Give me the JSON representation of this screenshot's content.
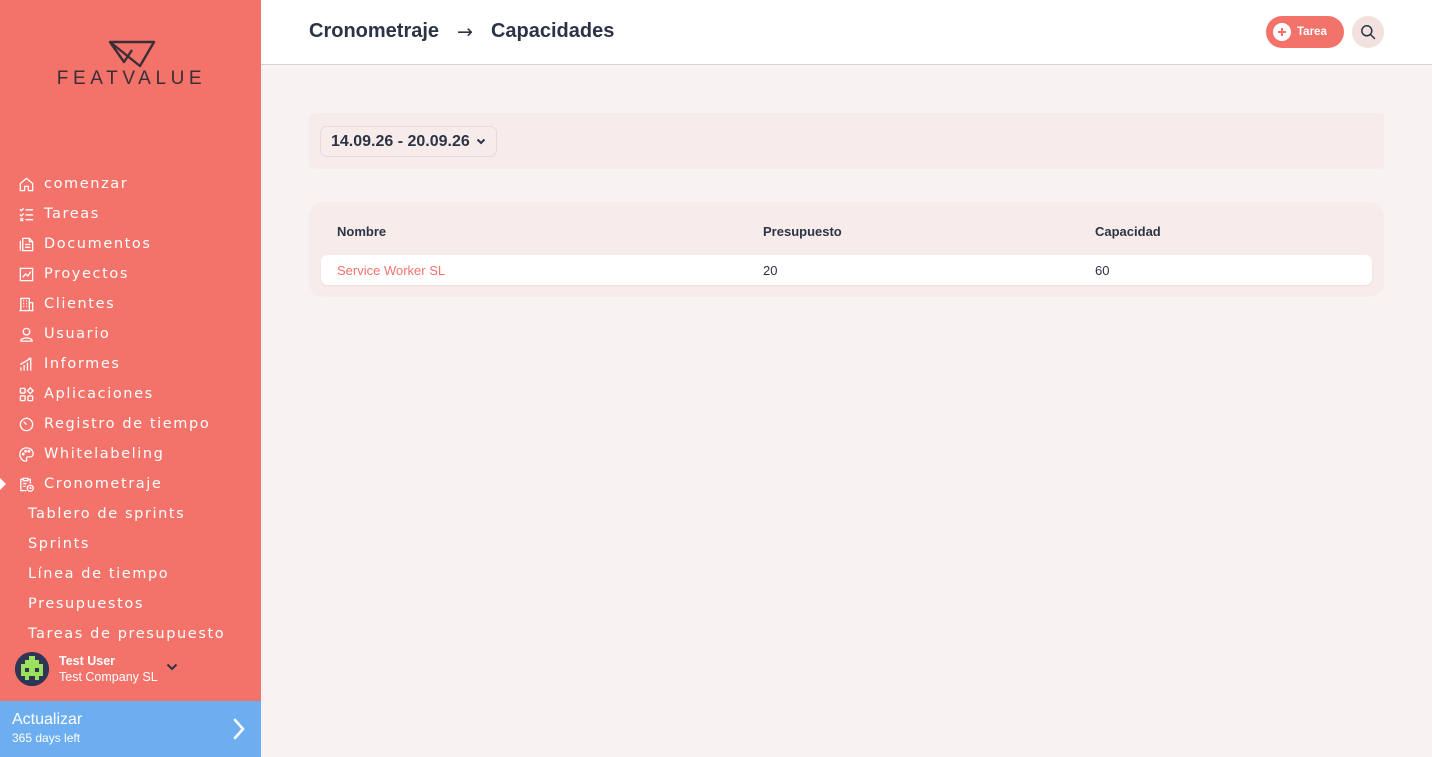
{
  "brand": {
    "logo_text": "FEATVALUE"
  },
  "sidebar": {
    "items": [
      {
        "label": "comenzar",
        "icon": "home-icon"
      },
      {
        "label": "Tareas",
        "icon": "task-list-icon"
      },
      {
        "label": "Documentos",
        "icon": "documents-icon"
      },
      {
        "label": "Proyectos",
        "icon": "projects-chart-icon"
      },
      {
        "label": "Clientes",
        "icon": "building-icon"
      },
      {
        "label": "Usuario",
        "icon": "user-icon"
      },
      {
        "label": "Informes",
        "icon": "bar-chart-icon"
      },
      {
        "label": "Aplicaciones",
        "icon": "apps-grid-icon"
      },
      {
        "label": "Registro de tiempo",
        "icon": "timer-icon"
      },
      {
        "label": "Whitelabeling",
        "icon": "palette-icon"
      },
      {
        "label": "Cronometraje",
        "icon": "clipboard-clock-icon",
        "active": true
      }
    ],
    "sub_items": [
      {
        "label": "Tablero de sprints"
      },
      {
        "label": "Sprints"
      },
      {
        "label": "Línea de tiempo"
      },
      {
        "label": "Presupuestos"
      },
      {
        "label": "Tareas de presupuesto"
      }
    ]
  },
  "user": {
    "name": "Test User",
    "company": "Test Company SL"
  },
  "upgrade": {
    "title": "Actualizar",
    "subtitle": "365 days left"
  },
  "header": {
    "breadcrumb": [
      "Cronometraje",
      "Capacidades"
    ],
    "separator": "→",
    "task_button_label": "Tarea"
  },
  "filter": {
    "date_range": "14.09.26 - 20.09.26"
  },
  "table": {
    "columns": [
      "Nombre",
      "Presupuesto",
      "Capacidad"
    ],
    "rows": [
      {
        "name": "Service Worker SL",
        "budget": "20",
        "capacity": "60"
      }
    ]
  },
  "colors": {
    "sidebar": "#f3736b",
    "accent": "#f3736b",
    "upgrade": "#6caef0",
    "text": "#2b3446",
    "card": "#f8eceb"
  }
}
